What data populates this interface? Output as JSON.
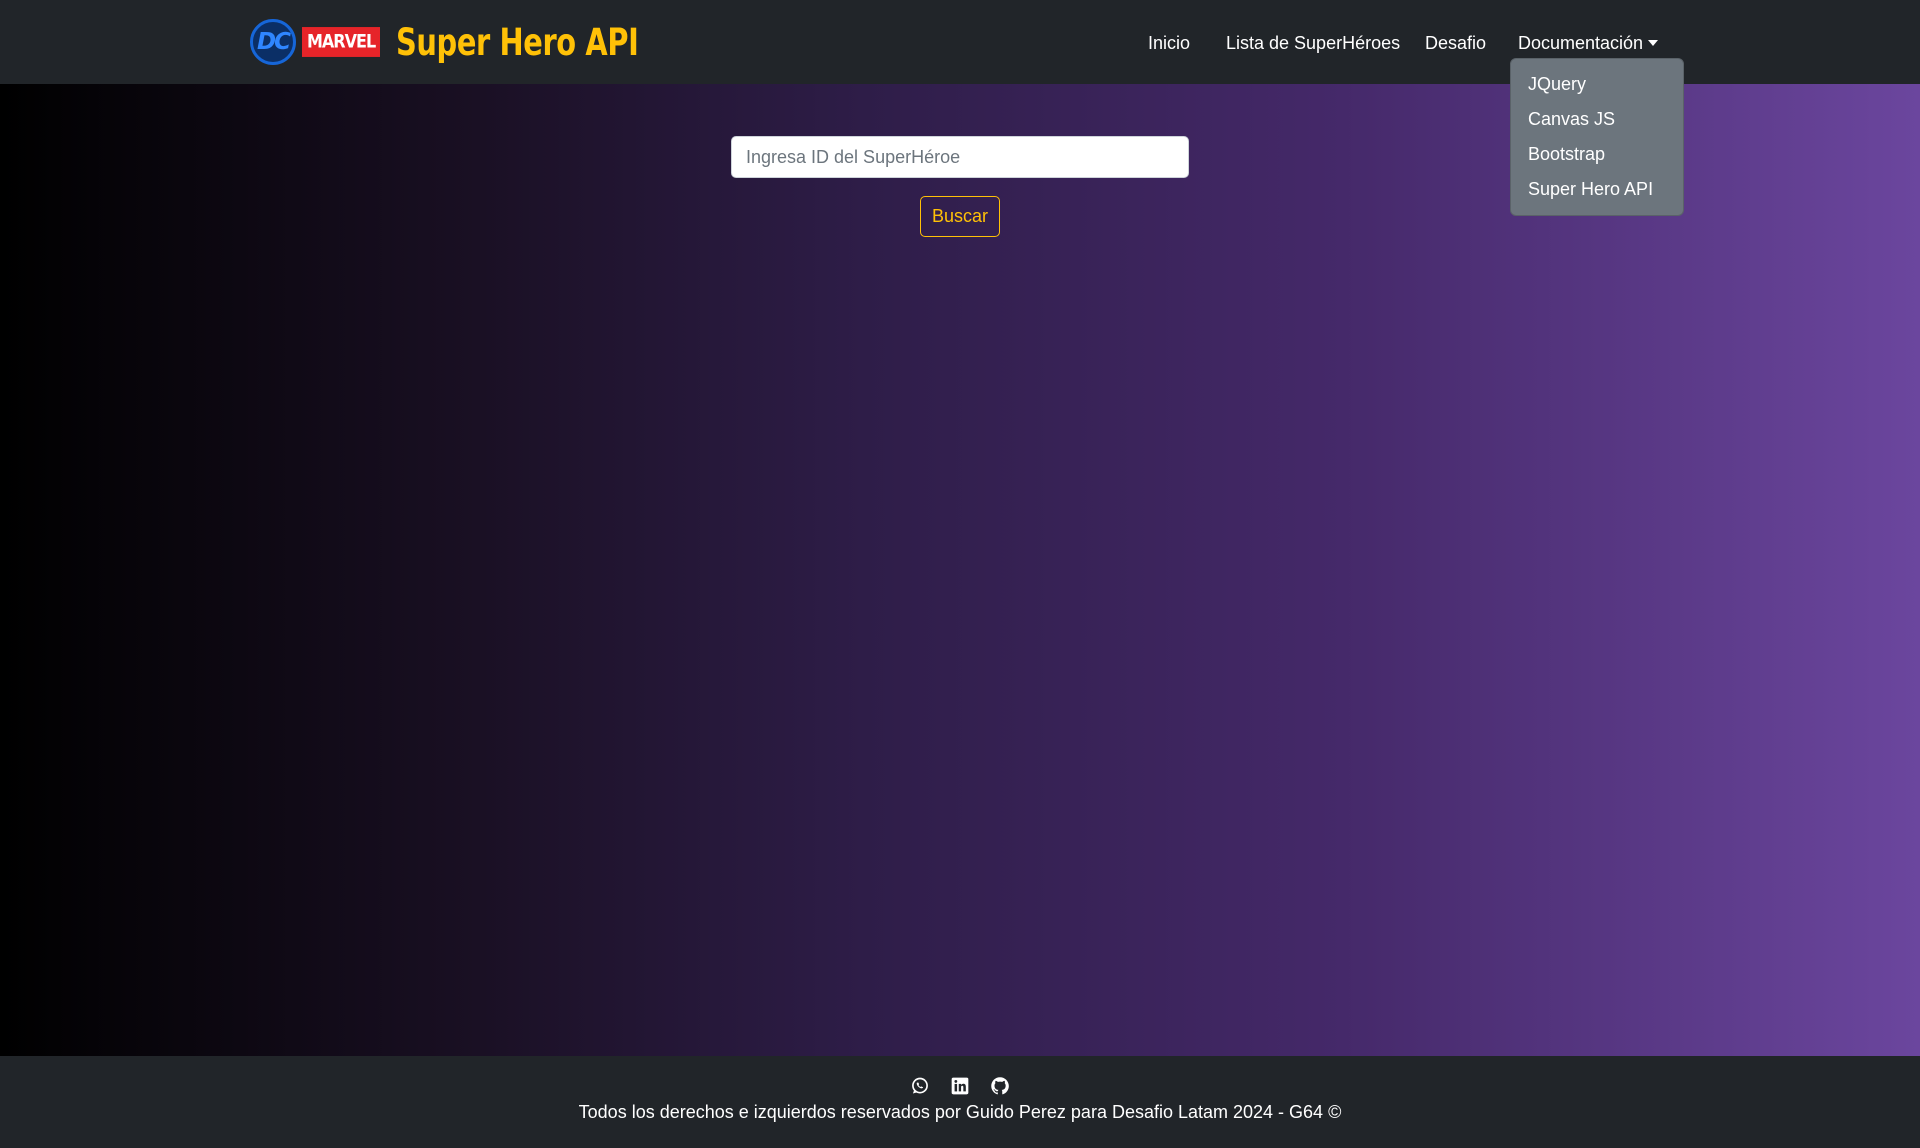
{
  "brand": {
    "dc_logo_text": "DC",
    "marvel_logo_text": "MARVEL",
    "title": "Super Hero API"
  },
  "nav": {
    "items": [
      {
        "label": "Inicio"
      },
      {
        "label": "Lista de SuperHéroes"
      },
      {
        "label": "Desafio"
      },
      {
        "label": "Documentación"
      }
    ]
  },
  "dropdown": {
    "open": true,
    "items": [
      {
        "label": "JQuery"
      },
      {
        "label": "Canvas JS"
      },
      {
        "label": "Bootstrap"
      },
      {
        "label": "Super Hero API"
      }
    ]
  },
  "search": {
    "placeholder": "Ingresa ID del SuperHéroe",
    "value": "",
    "button_label": "Buscar"
  },
  "footer": {
    "icons": [
      "whatsapp-icon",
      "linkedin-icon",
      "github-icon"
    ],
    "text": "Todos los derechos e izquierdos reservados por Guido Perez para Desafio Latam 2024 - G64 ©"
  },
  "colors": {
    "navbar_bg": "#212529",
    "brand_accent": "#ffc107",
    "dropdown_bg": "#6c757d",
    "gradient_start": "#000000",
    "gradient_end": "#6b469e"
  }
}
